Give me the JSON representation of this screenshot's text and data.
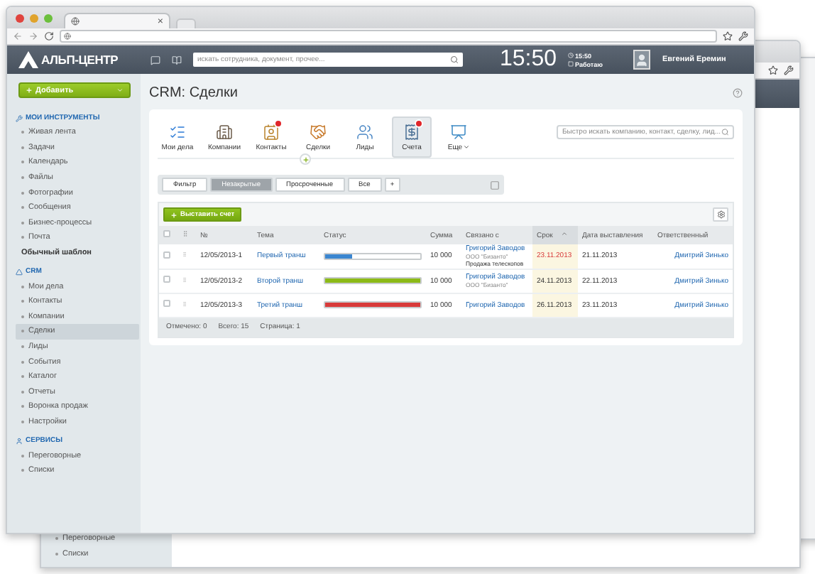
{
  "browser": {
    "tab_close": "×"
  },
  "header": {
    "logo": "АЛЬП-ЦЕНТР",
    "search": {
      "placeholder": "искать сотрудника, документ, прочее..."
    },
    "time": "15:50",
    "work_time": "15:50",
    "work_status": "Работаю",
    "user": "Евгений Еремин"
  },
  "sidebar": {
    "add_button": "Добавить",
    "sections": [
      {
        "title": "МОИ ИНСТРУМЕНТЫ",
        "kind": "tools",
        "items": [
          {
            "label": "Живая лента",
            "selected": false
          },
          {
            "label": "Задачи",
            "selected": false
          },
          {
            "label": "Календарь",
            "selected": false
          },
          {
            "label": "Файлы",
            "selected": false
          },
          {
            "label": "Фотографии",
            "selected": false
          },
          {
            "label": "Сообщения",
            "selected": false
          },
          {
            "label": "Бизнес-процессы",
            "selected": false
          },
          {
            "label": "Почта",
            "selected": false
          }
        ],
        "extra": "Обычный шаблон"
      },
      {
        "title": "CRM",
        "kind": "crm",
        "items": [
          {
            "label": "Мои дела",
            "selected": false
          },
          {
            "label": "Контакты",
            "selected": false
          },
          {
            "label": "Компании",
            "selected": false
          },
          {
            "label": "Сделки",
            "selected": true
          },
          {
            "label": "Лиды",
            "selected": false
          },
          {
            "label": "События",
            "selected": false
          },
          {
            "label": "Каталог",
            "selected": false
          },
          {
            "label": "Отчеты",
            "selected": false
          },
          {
            "label": "Воронка продаж",
            "selected": false
          },
          {
            "label": "Настройки",
            "selected": false
          }
        ]
      },
      {
        "title": "СЕРВИСЫ",
        "kind": "services",
        "items": [
          {
            "label": "Переговорные",
            "selected": false
          },
          {
            "label": "Списки",
            "selected": false
          }
        ]
      }
    ]
  },
  "page_title": "CRM: Сделки",
  "toolbar": {
    "items": [
      {
        "label": "Мои дела",
        "kind": "tasks",
        "alert": false,
        "selected": false
      },
      {
        "label": "Компании",
        "kind": "companies",
        "alert": false,
        "selected": false
      },
      {
        "label": "Контакты",
        "kind": "contacts",
        "alert": true,
        "selected": false
      },
      {
        "label": "Сделки",
        "kind": "deals",
        "alert": false,
        "selected": false
      },
      {
        "label": "Лиды",
        "kind": "leads",
        "alert": false,
        "selected": false
      },
      {
        "label": "Счета",
        "kind": "invoices",
        "alert": true,
        "selected": true
      },
      {
        "label": "Еще",
        "kind": "more",
        "alert": false,
        "selected": false
      }
    ],
    "search": {
      "placeholder": "Быстро искать компанию, контакт, сделку, лид..."
    }
  },
  "filters": [
    {
      "label": "Фильтр",
      "selected": false
    },
    {
      "label": "Незакрытые",
      "selected": true
    },
    {
      "label": "Просроченные",
      "selected": false
    },
    {
      "label": "Все",
      "selected": false
    },
    {
      "label": "+",
      "selected": false
    }
  ],
  "action_button": "Выставить счет",
  "table": {
    "all_checked": false,
    "columns": [
      {
        "label": "№",
        "sorted": false
      },
      {
        "label": "Тема",
        "sorted": false
      },
      {
        "label": "Статус",
        "sorted": false
      },
      {
        "label": "Сумма",
        "sorted": false
      },
      {
        "label": "Связано с",
        "sorted": false
      },
      {
        "label": "Срок",
        "sorted": true
      },
      {
        "label": "Дата выставления",
        "sorted": false
      },
      {
        "label": "Ответственный",
        "sorted": false
      }
    ],
    "rows": [
      {
        "checked": false,
        "number": "12/05/2013-1",
        "topic": "Первый транш",
        "status": {
          "level": 0.28,
          "color": "#3b86d0"
        },
        "sum": "10 000",
        "contact": "Григорий Заводов",
        "company": "ООО \"Бизанто\"",
        "deal": "Продажа телескопов",
        "due": "23.11.2013",
        "overdue": true,
        "issued": "21.11.2013",
        "responsible": "Дмитрий Зинько"
      },
      {
        "checked": false,
        "number": "12/05/2013-2",
        "topic": "Второй транш",
        "status": {
          "level": 1,
          "color": "#8cba17"
        },
        "sum": "10 000",
        "contact": "Григорий Заводов",
        "company": "ООО \"Бизанто\"",
        "due": "24.11.2013",
        "overdue": false,
        "issued": "22.11.2013",
        "responsible": "Дмитрий Зинько"
      },
      {
        "checked": false,
        "number": "12/05/2013-3",
        "topic": "Третий транш",
        "status": {
          "level": 1,
          "color": "#d83a3a"
        },
        "sum": "10 000",
        "contact": "Григорий Заводов",
        "due": "26.11.2013",
        "overdue": false,
        "issued": "23.11.2013",
        "responsible": "Дмитрий Зинько"
      }
    ],
    "footer": [
      "Отмечено: 0",
      "Всего: 15",
      "Страница: 1"
    ]
  },
  "back_window": {
    "sidebar_items": [
      "Переговорные",
      "Списки"
    ]
  }
}
